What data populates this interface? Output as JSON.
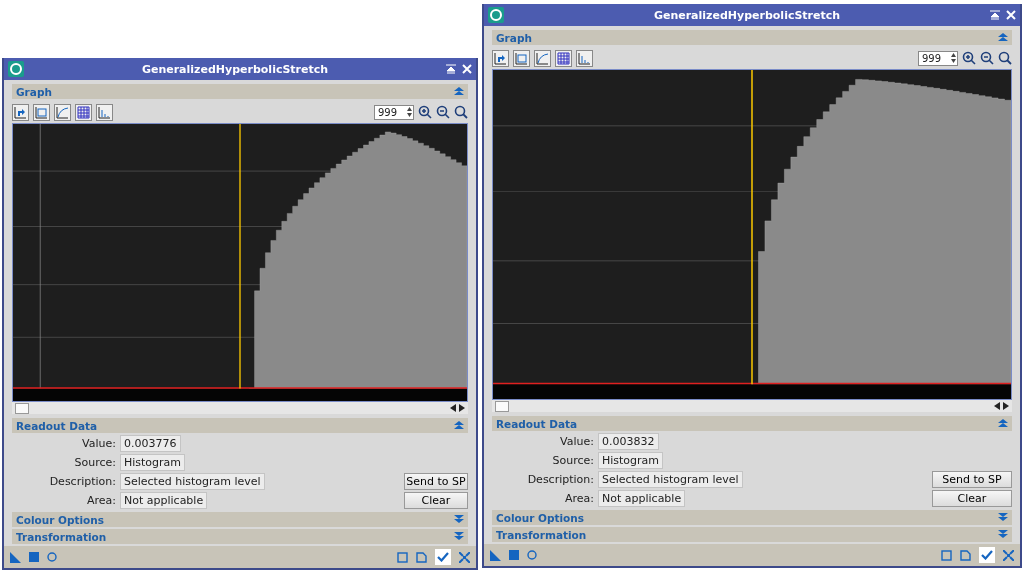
{
  "windows": [
    {
      "title": "GeneralizedHyperbolicStretch",
      "graph": {
        "title": "Graph",
        "expanded": true,
        "zoom": "999"
      },
      "readout": {
        "title": "Readout Data",
        "expanded": true,
        "fields": [
          {
            "label": "Value:",
            "value": "0.003776"
          },
          {
            "label": "Source:",
            "value": "Histogram"
          },
          {
            "label": "Description:",
            "value": "Selected histogram level"
          },
          {
            "label": "Area:",
            "value": "Not applicable"
          }
        ],
        "buttons": [
          "Send to SP",
          "Clear"
        ]
      },
      "sections": [
        {
          "title": "Colour Options",
          "expanded": false
        },
        {
          "title": "Transformation",
          "expanded": false
        }
      ]
    },
    {
      "title": "GeneralizedHyperbolicStretch",
      "graph": {
        "title": "Graph",
        "expanded": true,
        "zoom": "999"
      },
      "readout": {
        "title": "Readout Data",
        "expanded": true,
        "fields": [
          {
            "label": "Value:",
            "value": "0.003832"
          },
          {
            "label": "Source:",
            "value": "Histogram"
          },
          {
            "label": "Description:",
            "value": "Selected histogram level"
          },
          {
            "label": "Area:",
            "value": "Not applicable"
          }
        ],
        "buttons": [
          "Send to SP",
          "Clear"
        ]
      },
      "sections": [
        {
          "title": "Colour Options",
          "expanded": false
        },
        {
          "title": "Transformation",
          "expanded": false
        }
      ]
    }
  ]
}
